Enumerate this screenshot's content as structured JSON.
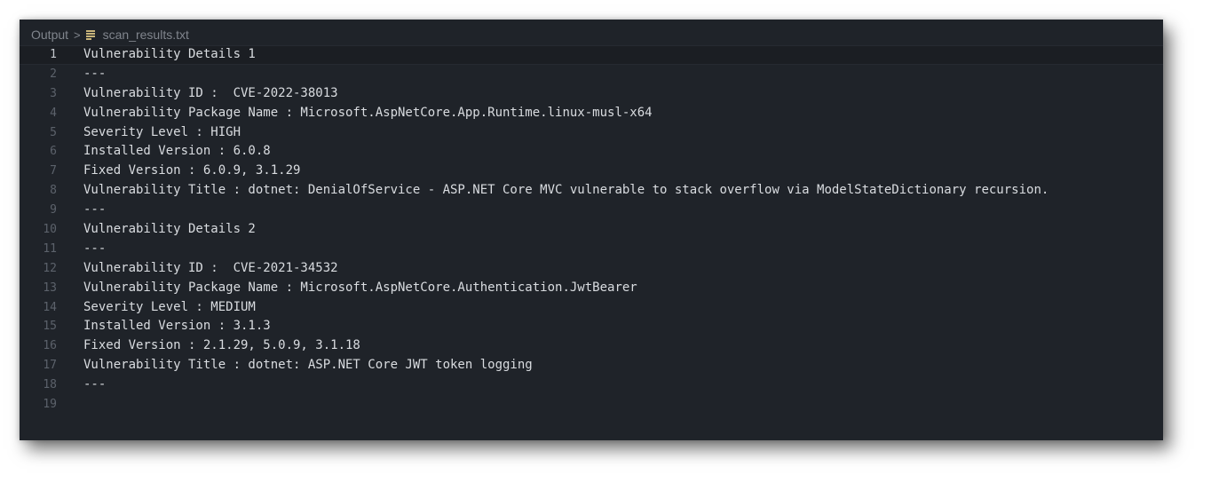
{
  "breadcrumb": {
    "root": "Output",
    "separator": ">",
    "file_icon": "text-file-icon",
    "file_name": "scan_results.txt"
  },
  "colors": {
    "editor_background": "#1f2329",
    "text": "#d9dce0",
    "line_number": "#5c626b"
  },
  "editor": {
    "current_line": 1,
    "lines": [
      {
        "number": "1",
        "text": "Vulnerability Details 1"
      },
      {
        "number": "2",
        "text": "---"
      },
      {
        "number": "3",
        "text": "Vulnerability ID :  CVE-2022-38013"
      },
      {
        "number": "4",
        "text": "Vulnerability Package Name : Microsoft.AspNetCore.App.Runtime.linux-musl-x64"
      },
      {
        "number": "5",
        "text": "Severity Level : HIGH"
      },
      {
        "number": "6",
        "text": "Installed Version : 6.0.8"
      },
      {
        "number": "7",
        "text": "Fixed Version : 6.0.9, 3.1.29"
      },
      {
        "number": "8",
        "text": "Vulnerability Title : dotnet: DenialOfService - ASP.NET Core MVC vulnerable to stack overflow via ModelStateDictionary recursion."
      },
      {
        "number": "9",
        "text": "---"
      },
      {
        "number": "10",
        "text": "Vulnerability Details 2"
      },
      {
        "number": "11",
        "text": "---"
      },
      {
        "number": "12",
        "text": "Vulnerability ID :  CVE-2021-34532"
      },
      {
        "number": "13",
        "text": "Vulnerability Package Name : Microsoft.AspNetCore.Authentication.JwtBearer"
      },
      {
        "number": "14",
        "text": "Severity Level : MEDIUM"
      },
      {
        "number": "15",
        "text": "Installed Version : 3.1.3"
      },
      {
        "number": "16",
        "text": "Fixed Version : 2.1.29, 5.0.9, 3.1.18"
      },
      {
        "number": "17",
        "text": "Vulnerability Title : dotnet: ASP.NET Core JWT token logging"
      },
      {
        "number": "18",
        "text": "---"
      },
      {
        "number": "19",
        "text": ""
      }
    ]
  }
}
